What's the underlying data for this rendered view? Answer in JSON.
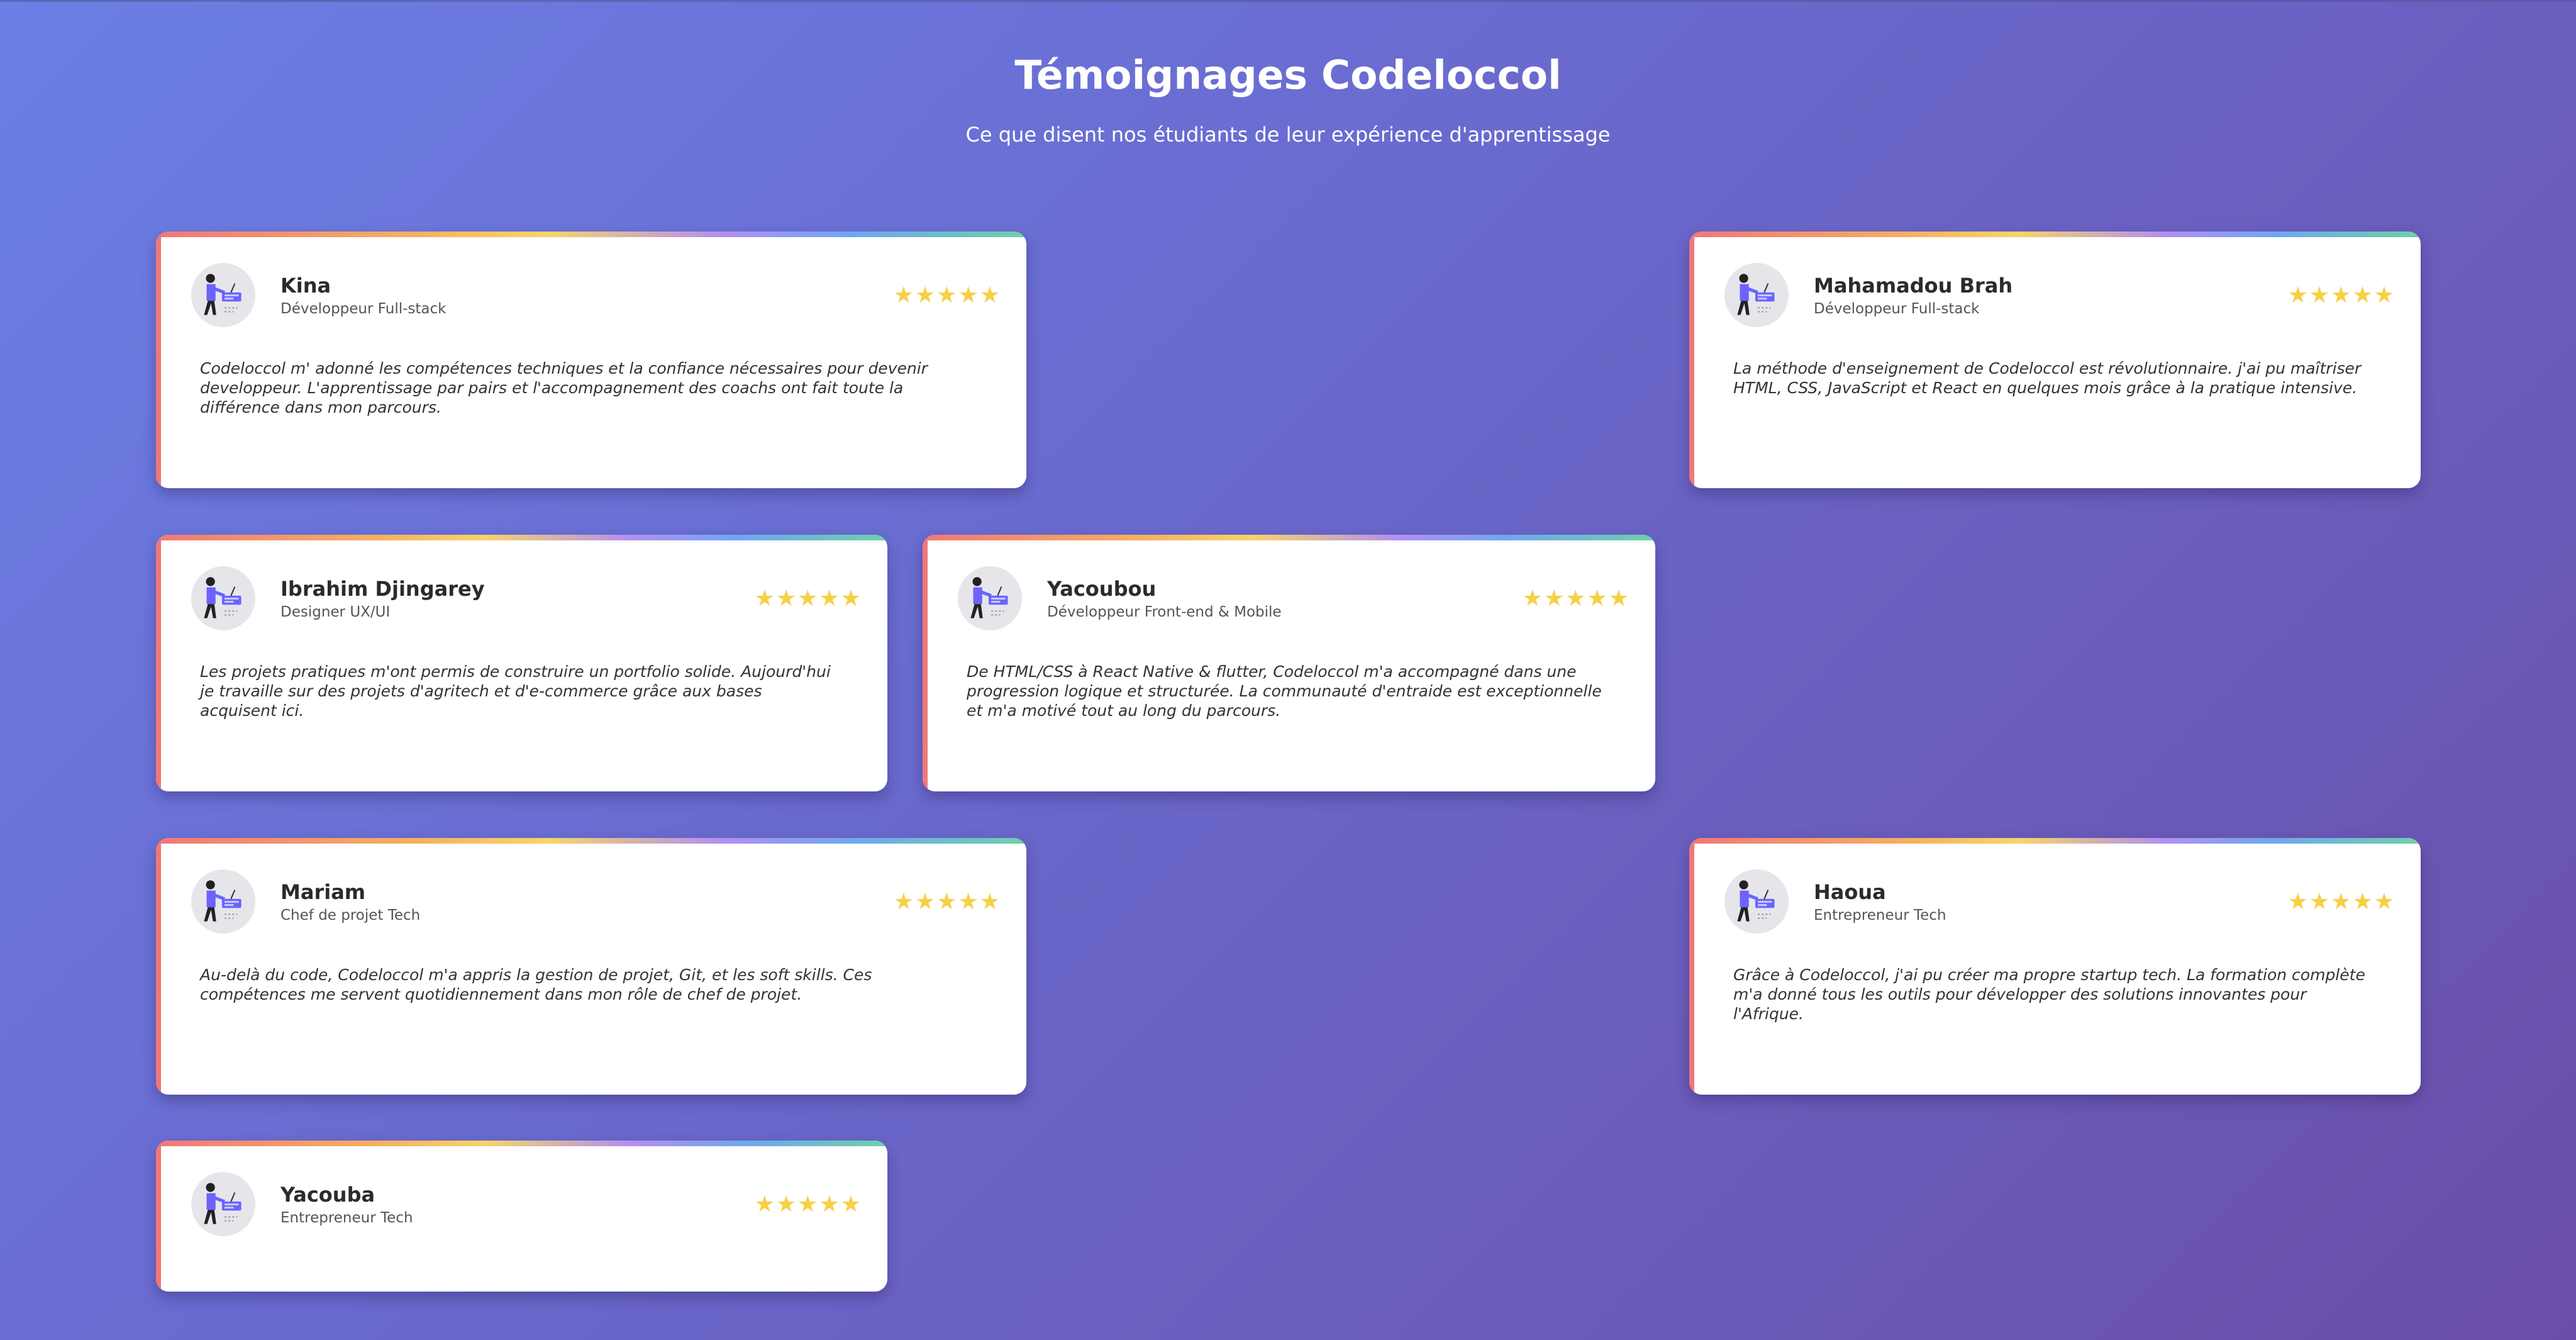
{
  "page": {
    "title": "Témoignages Codeloccol",
    "subtitle": "Ce que disent nos étudiants de leur expérience d'apprentissage"
  },
  "colors": {
    "star": "#f6d046",
    "accent_left": "#f07878",
    "background_start": "#6b7fe4",
    "background_end": "#6a4fa8"
  },
  "rating_stars": "★★★★★",
  "avatar_icon": "developer-at-laptop-illustration",
  "testimonials": [
    {
      "name": "Kina",
      "role": "Développeur Full-stack",
      "rating": 5,
      "quote": "Codeloccol m' adonné les compétences techniques et la confiance nécessaires pour devenir developpeur. L'apprentissage par pairs et l'accompagnement des coachs ont fait toute la différence dans mon parcours."
    },
    {
      "name": "Mahamadou Brah",
      "role": "Développeur Full-stack",
      "rating": 5,
      "quote": "La méthode d'enseignement de Codeloccol est révolutionnaire. j'ai pu maîtriser HTML, CSS, JavaScript et React en quelques mois grâce à la pratique intensive."
    },
    {
      "name": "Ibrahim Djingarey",
      "role": "Designer UX/UI",
      "rating": 5,
      "quote": "Les projets pratiques m'ont permis de construire un portfolio solide. Aujourd'hui je travaille sur des projets d'agritech et d'e-commerce grâce aux bases acquisent ici."
    },
    {
      "name": "Yacoubou",
      "role": "Développeur Front-end & Mobile",
      "rating": 5,
      "quote": "De HTML/CSS à React Native & flutter, Codeloccol m'a accompagné dans une progression logique et structurée. La communauté d'entraide est exceptionnelle et m'a motivé tout au long du parcours."
    },
    {
      "name": "Mariam",
      "role": "Chef de projet Tech",
      "rating": 5,
      "quote": "Au-delà du code, Codeloccol m'a appris la gestion de projet, Git, et les soft skills. Ces compétences me servent quotidiennement dans mon rôle de chef de projet."
    },
    {
      "name": "Haoua",
      "role": "Entrepreneur Tech",
      "rating": 5,
      "quote": "Grâce à Codeloccol, j'ai pu créer ma propre startup tech. La formation complète m'a donné tous les outils pour développer des solutions innovantes pour l'Afrique."
    },
    {
      "name": "Yacouba",
      "role": "Entrepreneur Tech",
      "rating": 5,
      "quote": ""
    }
  ]
}
